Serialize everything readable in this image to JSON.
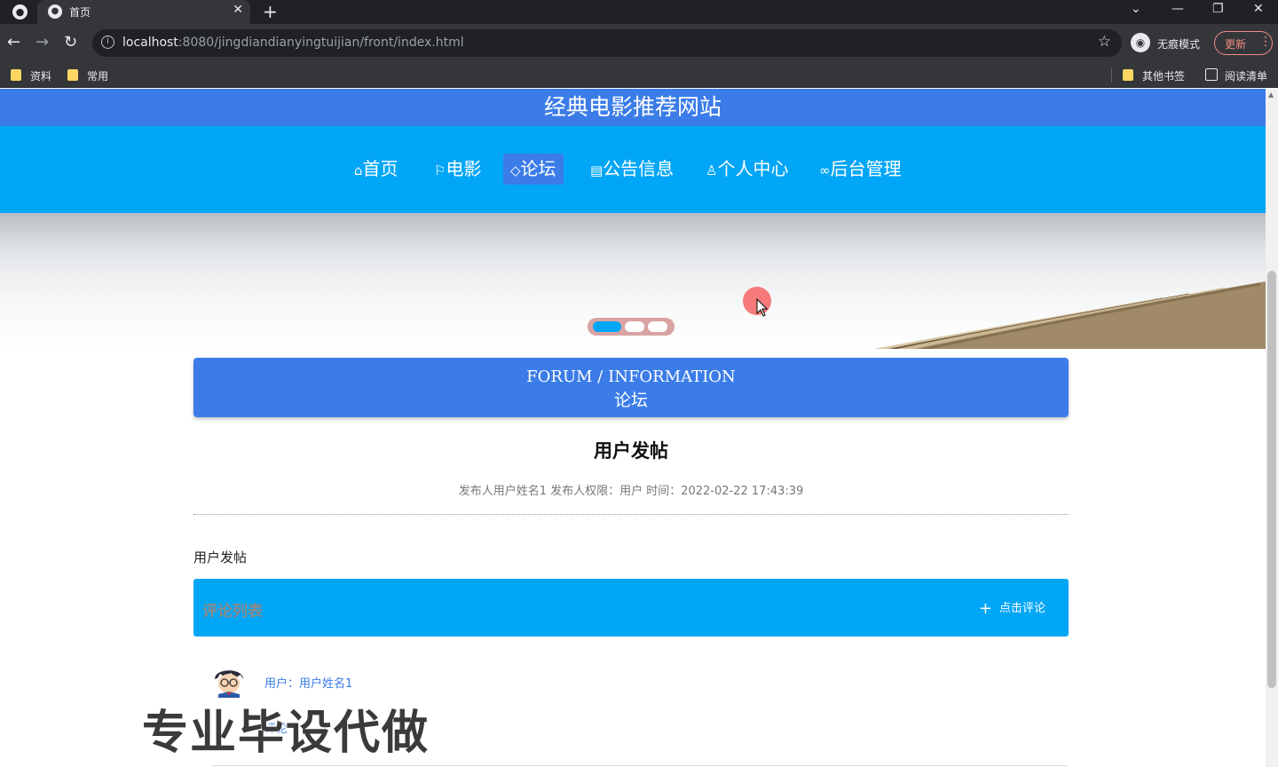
{
  "browser": {
    "tab_title": "首页",
    "tab_close": "✕",
    "new_tab": "+",
    "url_host": "localhost",
    "url_path": ":8080/jingdiandianyingtuijian/front/index.html",
    "incognito_label": "无痕模式",
    "update_label": "更新",
    "bookmarks": [
      "资料",
      "常用"
    ],
    "other_bookmarks": "其他书签",
    "reading_list": "阅读清单"
  },
  "site": {
    "title": "经典电影推荐网站",
    "nav": [
      {
        "icon": "home-icon",
        "glyph": "⌂",
        "label": "首页"
      },
      {
        "icon": "flag-icon",
        "glyph": "⚐",
        "label": "电影"
      },
      {
        "icon": "tag-icon",
        "glyph": "◇",
        "label": "论坛",
        "active": true
      },
      {
        "icon": "notice-icon",
        "glyph": "▤",
        "label": "公告信息"
      },
      {
        "icon": "user-icon",
        "glyph": "♙",
        "label": "个人中心"
      },
      {
        "icon": "link-icon",
        "glyph": "∞",
        "label": "后台管理"
      }
    ]
  },
  "carousel": {
    "slides": 3,
    "active_index": 0
  },
  "section": {
    "title_en": "FORUM / INFORMATION",
    "title_zh": "论坛"
  },
  "post": {
    "title": "用户发帖",
    "meta": "发布人用户姓名1   发布人权限：用户   时间：2022-02-22 17:43:39",
    "content": "用户发帖"
  },
  "comments": {
    "header": "评论列表",
    "add_button": "点击评论",
    "items": [
      {
        "user": "用户：用户姓名1",
        "text": "评论"
      }
    ]
  },
  "watermark": "专业毕设代做",
  "colors": {
    "header_blue": "#3b7ce8",
    "nav_blue": "#02a6f6"
  }
}
